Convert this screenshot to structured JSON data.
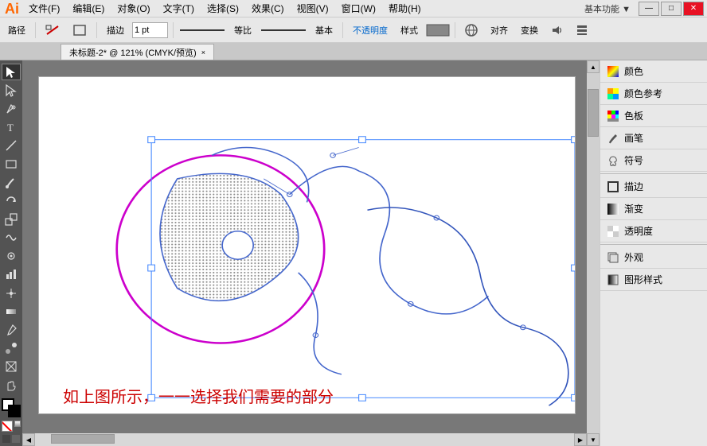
{
  "app": {
    "name": "Ai",
    "title": "Adobe Illustrator"
  },
  "titlebar": {
    "menus": [
      "文件(F)",
      "编辑(E)",
      "对象(O)",
      "文字(T)",
      "选择(S)",
      "效果(C)",
      "视图(V)",
      "窗口(W)",
      "帮助(H)"
    ],
    "workspace_label": "基本功能 ▼",
    "win_min": "—",
    "win_max": "□",
    "win_close": "✕"
  },
  "toolbar": {
    "path_label": "路径",
    "stroke_label": "描边",
    "stroke_value": "1 pt",
    "ratio_label": "等比",
    "base_label": "基本",
    "opacity_label": "不透明度",
    "style_label": "样式",
    "align_label": "对齐",
    "transform_label": "变换"
  },
  "tab": {
    "title": "未标题-2* @ 121% (CMYK/预览)",
    "close": "×"
  },
  "caption": "如上图所示，一一选择我们需要的部分",
  "right_panel": {
    "items": [
      {
        "label": "颜色",
        "icon": "color-icon"
      },
      {
        "label": "颜色参考",
        "icon": "colorref-icon"
      },
      {
        "label": "色板",
        "icon": "swatches-icon"
      },
      {
        "label": "画笔",
        "icon": "brush-icon"
      },
      {
        "label": "符号",
        "icon": "symbol-icon"
      },
      {
        "label": "描边",
        "icon": "stroke-icon"
      },
      {
        "label": "渐变",
        "icon": "gradient-icon"
      },
      {
        "label": "透明度",
        "icon": "transparency-icon"
      },
      {
        "label": "外观",
        "icon": "appearance-icon"
      },
      {
        "label": "图形样式",
        "icon": "graphicstyle-icon"
      }
    ]
  }
}
